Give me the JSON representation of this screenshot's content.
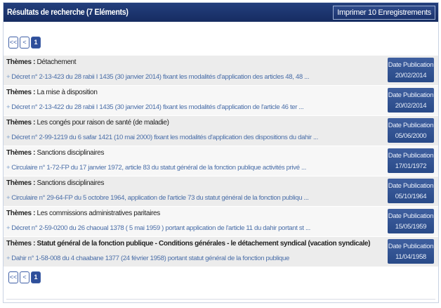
{
  "header": {
    "title": "Résultats de recherche (7 Eléments)",
    "print_label": "Imprimer 10 Enregistrements"
  },
  "pager": {
    "first": "<<",
    "prev": "<",
    "page": "1"
  },
  "theme_label": "Thèmes :",
  "link_prefix": "+",
  "date_label": "Date Publication",
  "results": [
    {
      "theme": "Détachement",
      "link": "Décret n° 2-13-423 du 28 rabii I 1435 (30 janvier 2014) fixant les modalités d'application des articles 48, 48 ...",
      "date": "20/02/2014"
    },
    {
      "theme": "La mise à disposition",
      "link": "Décret n° 2-13-422 du 28 rabii I 1435 (30 janvier 2014) fixant les modalités d'application de l'article 46 ter ...",
      "date": "20/02/2014"
    },
    {
      "theme": "Les congés pour raison de santé (de maladie)",
      "link": "Décret n° 2-99-1219 du 6 safar 1421 (10 mai 2000) fixant les modalités d'application des dispositions du dahir ...",
      "date": "05/06/2000"
    },
    {
      "theme": "Sanctions disciplinaires",
      "link": "Circulaire n° 1-72-FP du 17 janvier 1972, article 83 du statut général de la fonction publique activités privé ...",
      "date": "17/01/1972"
    },
    {
      "theme": "Sanctions disciplinaires",
      "link": "Circulaire n° 29-64-FP du 5 octobre 1964, application de l'article 73 du statut général de la fonction publiqu ...",
      "date": "05/10/1964"
    },
    {
      "theme": "Les commissions administratives paritaires",
      "link": "Décret n° 2-59-0200 du 26 chaoual 1378 ( 5 mai 1959 ) portant application de l'article 11 du dahir portant st ...",
      "date": "15/05/1959"
    },
    {
      "theme": "Statut général de la fonction publique - Conditions générales - le détachement syndical (vacation syndicale)",
      "link": "Dahir n° 1-58-008 du 4 chaabane 1377 (24 février 1958) portant statut général de la fonction publique",
      "date": "11/04/1958"
    }
  ]
}
